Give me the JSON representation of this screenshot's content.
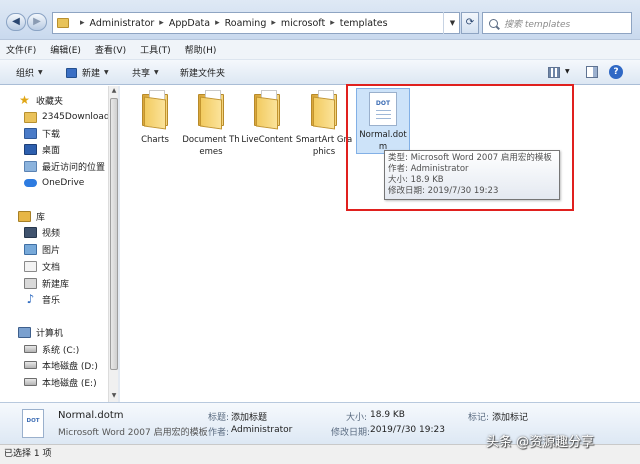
{
  "address": {
    "breadcrumbs": [
      "Administrator",
      "AppData",
      "Roaming",
      "microsoft",
      "templates"
    ],
    "search_placeholder": "搜索 templates"
  },
  "menu": [
    "文件(F)",
    "编辑(E)",
    "查看(V)",
    "工具(T)",
    "帮助(H)"
  ],
  "toolbar": {
    "organize": "组织",
    "new": "新建",
    "share": "共享",
    "new_folder": "新建文件夹"
  },
  "nav": {
    "favorites": "收藏夹",
    "fav_items": [
      "2345Downloads",
      "下载",
      "桌面",
      "最近访问的位置",
      "OneDrive"
    ],
    "library": "库",
    "lib_items": [
      "视频",
      "图片",
      "文档",
      "新建库",
      "音乐"
    ],
    "computer": "计算机",
    "drives": [
      "系统 (C:)",
      "本地磁盘 (D:)",
      "本地磁盘 (E:)"
    ]
  },
  "content": {
    "folders": [
      "Charts",
      "Document Themes",
      "LiveContent",
      "SmartArt Graphics"
    ],
    "selected_file": "Normal.dotm",
    "file_icon_text": "DOT",
    "tooltip": [
      "类型: Microsoft Word 2007 启用宏的模板",
      "作者: Administrator",
      "大小: 18.9 KB",
      "修改日期: 2019/7/30 19:23"
    ]
  },
  "details": {
    "name": "Normal.dotm",
    "type": "Microsoft Word 2007 启用宏的模板",
    "title_k": "标题:",
    "title_v": "添加标题",
    "author_k": "作者:",
    "author_v": "Administrator",
    "size_k": "大小:",
    "size_v": "18.9 KB",
    "modified_k": "修改日期:",
    "modified_v": "2019/7/30 19:23",
    "tag_k": "标记:",
    "tag_v": "添加标记"
  },
  "status": "已选择 1 项",
  "watermark": "头条 @资源趣分享",
  "colors": {
    "highlight": "#e0201e",
    "selection": "#cde3f9"
  }
}
